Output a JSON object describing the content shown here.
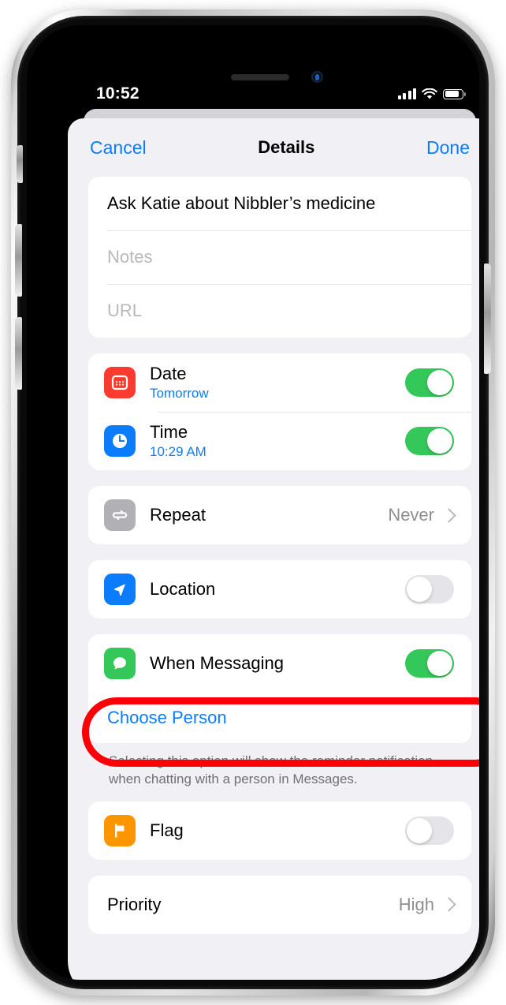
{
  "status_bar": {
    "time": "10:52",
    "cellular_icon": "signal-bars-icon",
    "wifi_icon": "wifi-icon",
    "battery_icon": "battery-icon"
  },
  "nav": {
    "cancel_label": "Cancel",
    "title": "Details",
    "done_label": "Done"
  },
  "fields": {
    "title_value": "Ask Katie about Nibbler’s medicine",
    "notes_placeholder": "Notes",
    "url_placeholder": "URL"
  },
  "rows": {
    "date": {
      "icon": "calendar-icon",
      "icon_color": "#fb3b30",
      "label": "Date",
      "sub": "Tomorrow",
      "toggle": "on"
    },
    "time": {
      "icon": "clock-icon",
      "icon_color": "#0b7cfb",
      "label": "Time",
      "sub": "10:29 AM",
      "toggle": "on"
    },
    "repeat": {
      "icon": "repeat-icon",
      "icon_color": "#b0b0b5",
      "label": "Repeat",
      "value": "Never",
      "accessory": "chevron-right-icon"
    },
    "location": {
      "icon": "location-arrow-icon",
      "icon_color": "#0b7cfb",
      "label": "Location",
      "toggle": "off"
    },
    "when_messaging": {
      "icon": "message-bubble-icon",
      "icon_color": "#34c759",
      "label": "When Messaging",
      "toggle": "on",
      "highlighted": true
    },
    "choose_person": {
      "label": "Choose Person"
    },
    "flag": {
      "icon": "flag-icon",
      "icon_color": "#fb9500",
      "label": "Flag",
      "toggle": "off"
    },
    "priority": {
      "label": "Priority",
      "value": "High",
      "accessory": "chevron-right-icon"
    }
  },
  "footnote": "Selecting this option will show the reminder notification when chatting with a person in Messages.",
  "annotation": {
    "type": "red-highlight-ring",
    "target": "when-messaging-row",
    "color": "#fb0007"
  },
  "colors": {
    "accent_blue": "#0b7cfb",
    "toggle_on_green": "#34c759",
    "toggle_off_gray": "#e4e4e9",
    "sheet_background": "#f1f1f5",
    "card_background": "#ffffff",
    "secondary_text": "#8e8e93"
  }
}
